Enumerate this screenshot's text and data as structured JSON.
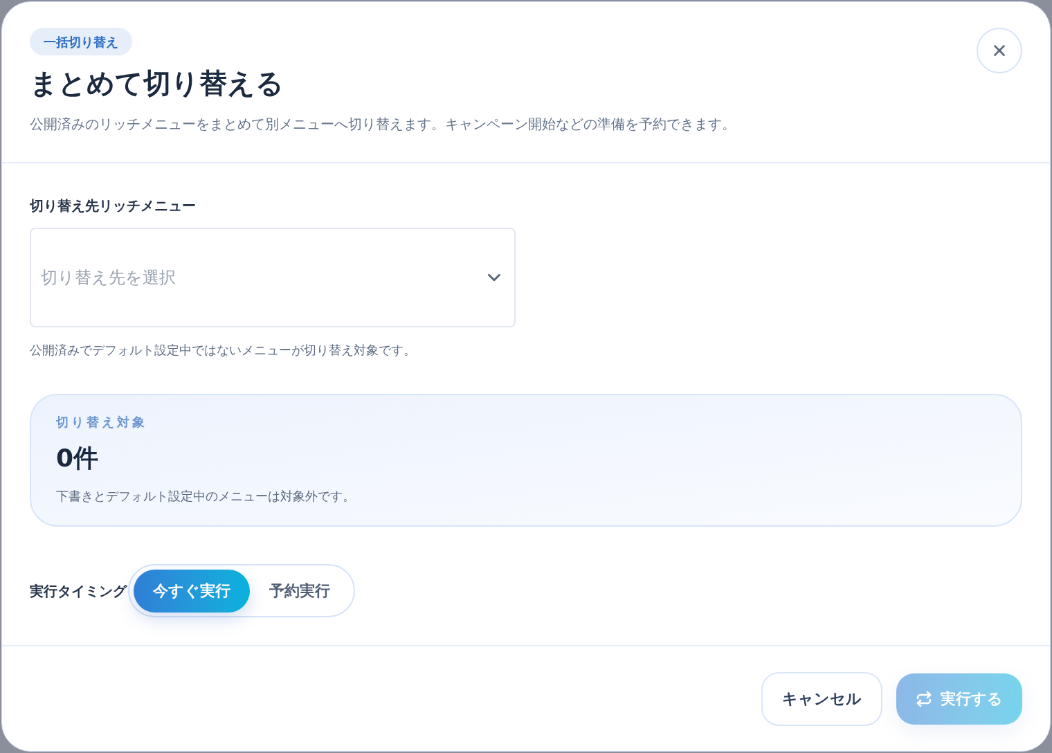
{
  "dialog": {
    "badge": "一括切り替え",
    "title": "まとめて切り替える",
    "description": "公開済みのリッチメニューをまとめて別メニューへ切り替えます。キャンペーン開始などの準備を予約できます。"
  },
  "target_menu": {
    "label": "切り替え先リッチメニュー",
    "placeholder": "切り替え先を選択",
    "help": "公開済みでデフォルト設定中ではないメニューが切り替え対象です。"
  },
  "summary": {
    "label": "切り替え対象",
    "count": "0件",
    "note": "下書きとデフォルト設定中のメニューは対象外です。"
  },
  "timing": {
    "label": "実行タイミング",
    "options": [
      {
        "label": "今すぐ実行",
        "selected": true
      },
      {
        "label": "予約実行",
        "selected": false
      }
    ]
  },
  "buttons": [
    {
      "kind": "secondary",
      "label": "キャンセル",
      "disabled": false
    },
    {
      "kind": "primary",
      "label": "実行する",
      "disabled": true
    }
  ]
}
